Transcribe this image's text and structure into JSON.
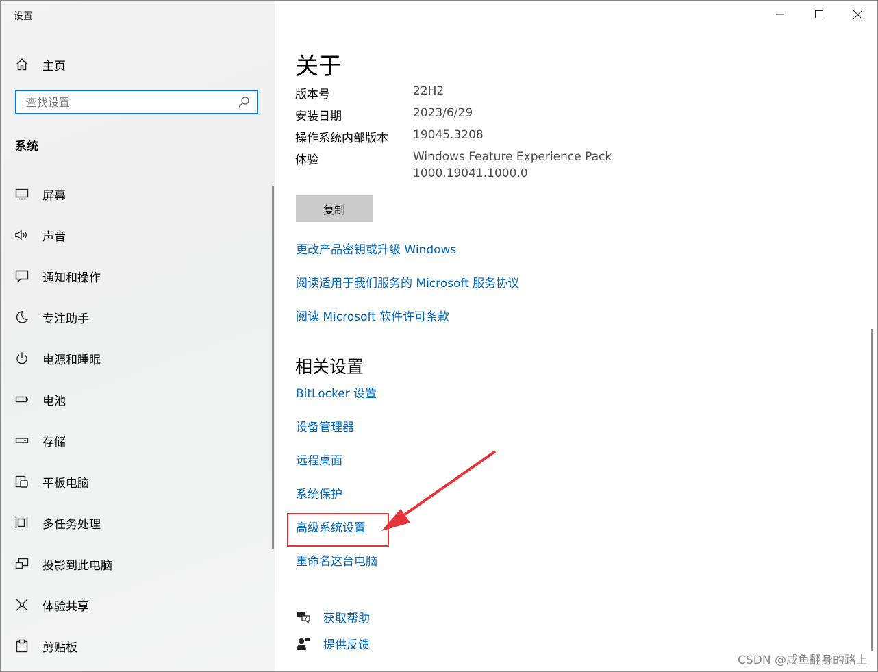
{
  "app": {
    "title": "设置"
  },
  "sidebar": {
    "home_label": "主页",
    "search_placeholder": "查找设置",
    "section_label": "系统",
    "items": [
      {
        "label": "屏幕",
        "icon": "display-icon"
      },
      {
        "label": "声音",
        "icon": "speaker-icon"
      },
      {
        "label": "通知和操作",
        "icon": "notification-icon"
      },
      {
        "label": "专注助手",
        "icon": "moon-icon"
      },
      {
        "label": "电源和睡眠",
        "icon": "power-icon"
      },
      {
        "label": "电池",
        "icon": "battery-icon"
      },
      {
        "label": "存储",
        "icon": "storage-icon"
      },
      {
        "label": "平板电脑",
        "icon": "tablet-icon"
      },
      {
        "label": "多任务处理",
        "icon": "multitask-icon"
      },
      {
        "label": "投影到此电脑",
        "icon": "project-icon"
      },
      {
        "label": "体验共享",
        "icon": "share-icon"
      },
      {
        "label": "剪贴板",
        "icon": "clipboard-icon"
      }
    ]
  },
  "main": {
    "title": "关于",
    "specs": [
      {
        "label": "版本号",
        "value": "22H2"
      },
      {
        "label": "安装日期",
        "value": "2023/6/29"
      },
      {
        "label": "操作系统内部版本",
        "value": "19045.3208"
      },
      {
        "label": "体验",
        "value": "Windows Feature Experience Pack",
        "value2": "1000.19041.1000.0"
      }
    ],
    "copy_label": "复制",
    "links": [
      "更改产品密钥或升级 Windows",
      "阅读适用于我们服务的 Microsoft 服务协议",
      "阅读 Microsoft 软件许可条款"
    ],
    "related_title": "相关设置",
    "related_links": [
      "BitLocker 设置",
      "设备管理器",
      "远程桌面",
      "系统保护",
      "高级系统设置",
      "重命名这台电脑"
    ],
    "help": {
      "get_help": "获取帮助",
      "feedback": "提供反馈"
    }
  },
  "watermark": "CSDN @咸鱼翻身的路上",
  "colors": {
    "accent": "#0078d7",
    "link": "#0067c0",
    "annotation": "#e3343a"
  }
}
